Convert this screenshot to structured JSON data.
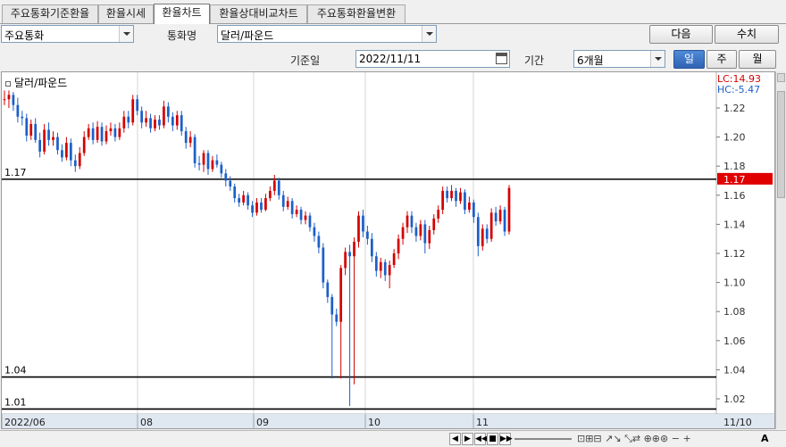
{
  "tabs": [
    {
      "label": "주요통화기준환율",
      "active": false
    },
    {
      "label": "환율시세",
      "active": false
    },
    {
      "label": "환율차트",
      "active": true
    },
    {
      "label": "환율상대비교차트",
      "active": false
    },
    {
      "label": "주요통화환율변환",
      "active": false
    }
  ],
  "filters": {
    "group_value": "주요통화",
    "currency_label": "통화명",
    "currency_value": "달러/파운드",
    "date_label": "기준일",
    "date_value": "2022/11/11",
    "period_label": "기간",
    "period_value": "6개월"
  },
  "buttons": {
    "next": "다음",
    "fetch": "수치",
    "day": "일",
    "week": "주",
    "month": "월"
  },
  "chart": {
    "title": "달러/파운드",
    "lc_text": "LC:14.93",
    "hc_text": "HC:-5.47",
    "current_price": "1.17",
    "hlines": [
      {
        "label": "1.17",
        "value": 1.171
      },
      {
        "label": "1.04",
        "value": 1.035
      },
      {
        "label": "1.01",
        "value": 1.013
      }
    ],
    "y_ticks": [
      "1.22",
      "1.20",
      "1.18",
      "1.16",
      "1.14",
      "1.12",
      "1.10",
      "1.08",
      "1.06",
      "1.04",
      "1.02"
    ],
    "x_ticks": [
      "2022/06",
      "08",
      "09",
      "10",
      "11"
    ],
    "date_corner": "11/10",
    "colors": {
      "up": "#d40000",
      "down": "#1c5fc9",
      "price_badge": "#e00000",
      "lc": "#d40000",
      "hc": "#1c5fc9"
    }
  },
  "chart_data": {
    "type": "candlestick",
    "title": "달러/파운드",
    "ylim": [
      1.005,
      1.235
    ],
    "y_ticks": [
      1.22,
      1.2,
      1.18,
      1.16,
      1.14,
      1.12,
      1.1,
      1.08,
      1.06,
      1.04,
      1.02
    ],
    "x_ticks": [
      "2022/06",
      "08",
      "09",
      "10",
      "11"
    ],
    "candles": [
      [
        1.226,
        1.226,
        1.232,
        1.222
      ],
      [
        1.226,
        1.229,
        1.232,
        1.22
      ],
      [
        1.229,
        1.222,
        1.231,
        1.218
      ],
      [
        1.222,
        1.214,
        1.227,
        1.21
      ],
      [
        1.214,
        1.213,
        1.218,
        1.208
      ],
      [
        1.213,
        1.201,
        1.216,
        1.197
      ],
      [
        1.201,
        1.209,
        1.212,
        1.198
      ],
      [
        1.209,
        1.198,
        1.213,
        1.196
      ],
      [
        1.198,
        1.19,
        1.203,
        1.186
      ],
      [
        1.19,
        1.205,
        1.209,
        1.188
      ],
      [
        1.205,
        1.198,
        1.21,
        1.194
      ],
      [
        1.198,
        1.2,
        1.204,
        1.194
      ],
      [
        1.2,
        1.191,
        1.203,
        1.188
      ],
      [
        1.191,
        1.186,
        1.195,
        1.183
      ],
      [
        1.186,
        1.196,
        1.2,
        1.184
      ],
      [
        1.196,
        1.184,
        1.199,
        1.18
      ],
      [
        1.184,
        1.18,
        1.188,
        1.176
      ],
      [
        1.18,
        1.189,
        1.193,
        1.178
      ],
      [
        1.189,
        1.2,
        1.204,
        1.187
      ],
      [
        1.2,
        1.206,
        1.209,
        1.198
      ],
      [
        1.206,
        1.198,
        1.21,
        1.195
      ],
      [
        1.198,
        1.207,
        1.211,
        1.196
      ],
      [
        1.207,
        1.197,
        1.21,
        1.194
      ],
      [
        1.197,
        1.204,
        1.208,
        1.195
      ],
      [
        1.204,
        1.206,
        1.21,
        1.201
      ],
      [
        1.206,
        1.2,
        1.209,
        1.197
      ],
      [
        1.2,
        1.206,
        1.21,
        1.198
      ],
      [
        1.206,
        1.214,
        1.218,
        1.203
      ],
      [
        1.214,
        1.21,
        1.218,
        1.206
      ],
      [
        1.21,
        1.226,
        1.229,
        1.208
      ],
      [
        1.226,
        1.218,
        1.229,
        1.215
      ],
      [
        1.218,
        1.21,
        1.221,
        1.206
      ],
      [
        1.21,
        1.213,
        1.218,
        1.207
      ],
      [
        1.213,
        1.206,
        1.216,
        1.203
      ],
      [
        1.206,
        1.212,
        1.215,
        1.204
      ],
      [
        1.212,
        1.208,
        1.215,
        1.205
      ],
      [
        1.208,
        1.221,
        1.225,
        1.206
      ],
      [
        1.221,
        1.214,
        1.224,
        1.21
      ],
      [
        1.214,
        1.208,
        1.217,
        1.204
      ],
      [
        1.208,
        1.215,
        1.218,
        1.205
      ],
      [
        1.215,
        1.204,
        1.218,
        1.201
      ],
      [
        1.204,
        1.196,
        1.207,
        1.192
      ],
      [
        1.196,
        1.2,
        1.204,
        1.193
      ],
      [
        1.2,
        1.182,
        1.202,
        1.179
      ],
      [
        1.182,
        1.181,
        1.187,
        1.177
      ],
      [
        1.181,
        1.189,
        1.191,
        1.176
      ],
      [
        1.189,
        1.178,
        1.191,
        1.174
      ],
      [
        1.178,
        1.184,
        1.187,
        1.176
      ],
      [
        1.184,
        1.181,
        1.188,
        1.179
      ],
      [
        1.181,
        1.175,
        1.183,
        1.172
      ],
      [
        1.175,
        1.17,
        1.178,
        1.166
      ],
      [
        1.17,
        1.166,
        1.173,
        1.163
      ],
      [
        1.166,
        1.158,
        1.168,
        1.155
      ],
      [
        1.158,
        1.155,
        1.161,
        1.152
      ],
      [
        1.155,
        1.16,
        1.163,
        1.153
      ],
      [
        1.16,
        1.153,
        1.162,
        1.15
      ],
      [
        1.153,
        1.148,
        1.156,
        1.145
      ],
      [
        1.148,
        1.155,
        1.158,
        1.146
      ],
      [
        1.155,
        1.15,
        1.158,
        1.148
      ],
      [
        1.15,
        1.158,
        1.161,
        1.149
      ],
      [
        1.158,
        1.163,
        1.166,
        1.156
      ],
      [
        1.163,
        1.17,
        1.174,
        1.16
      ],
      [
        1.17,
        1.16,
        1.172,
        1.157
      ],
      [
        1.16,
        1.152,
        1.163,
        1.149
      ],
      [
        1.152,
        1.156,
        1.159,
        1.15
      ],
      [
        1.156,
        1.147,
        1.158,
        1.144
      ],
      [
        1.147,
        1.15,
        1.153,
        1.145
      ],
      [
        1.15,
        1.143,
        1.152,
        1.14
      ],
      [
        1.143,
        1.146,
        1.149,
        1.14
      ],
      [
        1.146,
        1.138,
        1.148,
        1.135
      ],
      [
        1.138,
        1.132,
        1.141,
        1.128
      ],
      [
        1.132,
        1.124,
        1.135,
        1.12
      ],
      [
        1.124,
        1.1,
        1.127,
        1.096
      ],
      [
        1.1,
        1.09,
        1.102,
        1.086
      ],
      [
        1.09,
        1.078,
        1.092,
        1.034
      ],
      [
        1.078,
        1.073,
        1.082,
        1.07
      ],
      [
        1.073,
        1.11,
        1.112,
        1.034
      ],
      [
        1.11,
        1.121,
        1.124,
        1.105
      ],
      [
        1.121,
        1.118,
        1.126,
        1.015
      ],
      [
        1.118,
        1.128,
        1.131,
        1.03
      ],
      [
        1.128,
        1.146,
        1.149,
        1.124
      ],
      [
        1.146,
        1.135,
        1.15,
        1.131
      ],
      [
        1.135,
        1.13,
        1.139,
        1.126
      ],
      [
        1.13,
        1.118,
        1.134,
        1.114
      ],
      [
        1.118,
        1.108,
        1.121,
        1.104
      ],
      [
        1.108,
        1.114,
        1.117,
        1.103
      ],
      [
        1.114,
        1.105,
        1.116,
        1.101
      ],
      [
        1.105,
        1.112,
        1.115,
        1.096
      ],
      [
        1.112,
        1.12,
        1.123,
        1.11
      ],
      [
        1.12,
        1.13,
        1.133,
        1.116
      ],
      [
        1.13,
        1.138,
        1.141,
        1.126
      ],
      [
        1.138,
        1.146,
        1.149,
        1.134
      ],
      [
        1.146,
        1.138,
        1.149,
        1.134
      ],
      [
        1.138,
        1.132,
        1.141,
        1.128
      ],
      [
        1.132,
        1.14,
        1.143,
        1.129
      ],
      [
        1.14,
        1.127,
        1.143,
        1.12
      ],
      [
        1.127,
        1.136,
        1.139,
        1.123
      ],
      [
        1.136,
        1.144,
        1.147,
        1.133
      ],
      [
        1.144,
        1.15,
        1.153,
        1.141
      ],
      [
        1.15,
        1.163,
        1.166,
        1.147
      ],
      [
        1.163,
        1.158,
        1.166,
        1.155
      ],
      [
        1.158,
        1.163,
        1.167,
        1.156
      ],
      [
        1.163,
        1.156,
        1.165,
        1.152
      ],
      [
        1.156,
        1.162,
        1.165,
        1.154
      ],
      [
        1.162,
        1.15,
        1.164,
        1.147
      ],
      [
        1.15,
        1.155,
        1.159,
        1.148
      ],
      [
        1.155,
        1.145,
        1.157,
        1.141
      ],
      [
        1.145,
        1.125,
        1.148,
        1.118
      ],
      [
        1.125,
        1.137,
        1.14,
        1.122
      ],
      [
        1.137,
        1.13,
        1.14,
        1.127
      ],
      [
        1.13,
        1.148,
        1.151,
        1.128
      ],
      [
        1.148,
        1.142,
        1.152,
        1.139
      ],
      [
        1.142,
        1.15,
        1.153,
        1.14
      ],
      [
        1.15,
        1.135,
        1.152,
        1.132
      ],
      [
        1.135,
        1.165,
        1.167,
        1.133
      ]
    ]
  }
}
